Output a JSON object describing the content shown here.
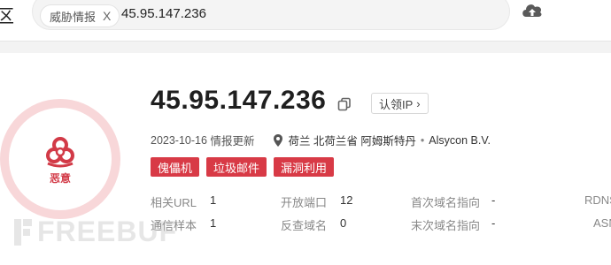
{
  "header": {
    "edge_char": "区",
    "search": {
      "chip_label": "威胁情报",
      "chip_close": "X",
      "query": "45.95.147.236"
    },
    "upload_icon": "cloud-upload-icon"
  },
  "result": {
    "verdict_icon": "biohazard-icon",
    "verdict_label": "恶意",
    "ip": "45.95.147.236",
    "copy_icon": "copy-icon",
    "claim_button": "认领IP",
    "claim_chevron": "›",
    "date": "2023-10-16",
    "date_suffix": "情报更新",
    "location_icon": "map-pin-icon",
    "location": "荷兰 北荷兰省 阿姆斯特丹",
    "separator": "•",
    "org": "Alsycon B.V.",
    "tags": [
      "傀儡机",
      "垃圾邮件",
      "漏洞利用"
    ],
    "stats": {
      "related_url_label": "相关URL",
      "related_url_value": "1",
      "samples_label": "通信样本",
      "samples_value": "1",
      "open_ports_label": "开放端口",
      "open_ports_value": "12",
      "reverse_domain_label": "反查域名",
      "reverse_domain_value": "0",
      "first_domain_label": "首次域名指向",
      "first_domain_value": "-",
      "last_domain_label": "末次域名指向",
      "last_domain_value": "-",
      "rdns_label": "RDNS",
      "asn_label": "ASN"
    }
  },
  "watermark": "FREEBUF",
  "colors": {
    "accent_red": "#d83a46",
    "ring": "#f8d7d9"
  }
}
